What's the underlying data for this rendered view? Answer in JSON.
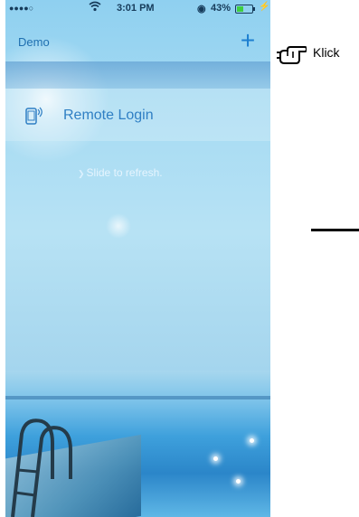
{
  "status_bar": {
    "signal": "●●●●○",
    "wifi_icon": "wifi-icon",
    "time": "3:01 PM",
    "clock_icon": "alarm-icon",
    "battery": "43%",
    "battery_level": 0.43,
    "charging_icon": "bolt-icon"
  },
  "nav": {
    "title": "Demo",
    "add_label": "+"
  },
  "list": [
    {
      "icon": "remote-device-icon",
      "label": "Remote Login"
    }
  ],
  "refresh_hint": "Slide to refresh.",
  "annotation": {
    "label": "Klick",
    "icon": "pointing-hand-icon"
  },
  "colors": {
    "accent": "#2f7fc4",
    "nav_title": "#1f6fb0",
    "battery_fill": "#3fcf3f"
  }
}
